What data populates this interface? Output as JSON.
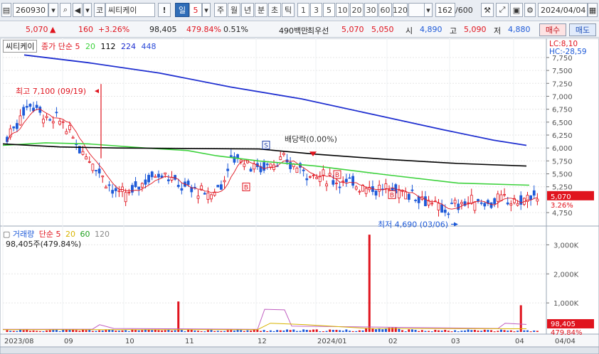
{
  "toolbar": {
    "code": "260930",
    "market_badge": "코",
    "name": "씨티케이",
    "excl": "!",
    "period": "일",
    "period_n": "5",
    "period_tabs": [
      "주",
      "월",
      "년",
      "분",
      "초",
      "틱"
    ],
    "minute_opts": [
      "1",
      "3",
      "5",
      "10",
      "20",
      "30",
      "60",
      "120"
    ],
    "count": "162",
    "count_max": "/600",
    "date": "2024/04/04"
  },
  "quote": {
    "price": "5,070",
    "arrow": "▲",
    "change": "160",
    "change_pct": "+3.26%",
    "volume": "98,405",
    "volume_ratio": "479.84%",
    "turnover": "0.51%",
    "amount": "490백만",
    "best_label": "최우선",
    "ask": "5,070",
    "bid": "5,050",
    "open_label": "시",
    "open": "4,890",
    "high_label": "고",
    "high": "5,090",
    "low_label": "저",
    "low": "4,880",
    "buy": "매수",
    "sell": "매도"
  },
  "colors": {
    "up": "#e0141e",
    "down": "#1e5ad8",
    "ma5": "#e0141e",
    "ma20": "#3cd23c",
    "ma112": "#000000",
    "ma224": "#1f2fd0",
    "ma448": "#2a4ad8",
    "vol_ma5": "#e0141e",
    "vol_ma20": "#d8b400",
    "vol_ma60": "#1ea01e",
    "vol_ma120": "#ff66cc"
  },
  "chart_data": [
    {
      "type": "candlestick",
      "title": "씨티케이",
      "legend": [
        {
          "name": "종가 단순 5",
          "color": "#e0141e"
        },
        {
          "name": "20",
          "color": "#3cd23c"
        },
        {
          "name": "112",
          "color": "#000000"
        },
        {
          "name": "224",
          "color": "#1f2fd0"
        },
        {
          "name": "448",
          "color": "#2a4ad8"
        }
      ],
      "yticks": [
        7750,
        7500,
        7250,
        7000,
        6750,
        6500,
        6250,
        6000,
        5750,
        5500,
        5250,
        4750
      ],
      "ylim": [
        4600,
        7900
      ],
      "xticks": [
        "2023/08",
        "09",
        "10",
        "11",
        "12",
        "2024/01",
        "02",
        "03",
        "04"
      ],
      "right_axis_labels": [
        "LC:8,10",
        "HC:-28,59"
      ],
      "current_price_label": "5,070",
      "current_pct_label": "3.26%",
      "annotations": {
        "high": "최고 7,100 (09/19)",
        "low": "최저 4,690 (03/06)",
        "dividend": "배당락(0.00%)",
        "split_marker": "S",
        "b_markers": [
          "B",
          "B",
          "B"
        ]
      },
      "high_value": 7100,
      "low_value": 4690,
      "ma112_end": 5650,
      "ma224_end": 6050,
      "ma20_end": 5280
    },
    {
      "type": "bar",
      "title": "거래량",
      "legend": [
        {
          "name": "단순 5",
          "color": "#e0141e"
        },
        {
          "name": "20",
          "color": "#d8b400"
        },
        {
          "name": "60",
          "color": "#1ea01e"
        },
        {
          "name": "120",
          "color": "#888888"
        }
      ],
      "current_label": "98,405주(479.84%)",
      "yticks": [
        3000000,
        2000000,
        1000000
      ],
      "ytick_labels": [
        "3,000K",
        "2,000K",
        "1,000K"
      ],
      "ylim": [
        0,
        3500000
      ],
      "current_value_label": "98,405",
      "current_pct_label": "479.84%",
      "spikes": [
        {
          "x": "09/19",
          "value": 1050000
        },
        {
          "x": "12/08",
          "value": 3350000
        },
        {
          "x": "04/01",
          "value": 920000
        }
      ]
    }
  ],
  "bottom": {
    "date_label": "04/04"
  }
}
